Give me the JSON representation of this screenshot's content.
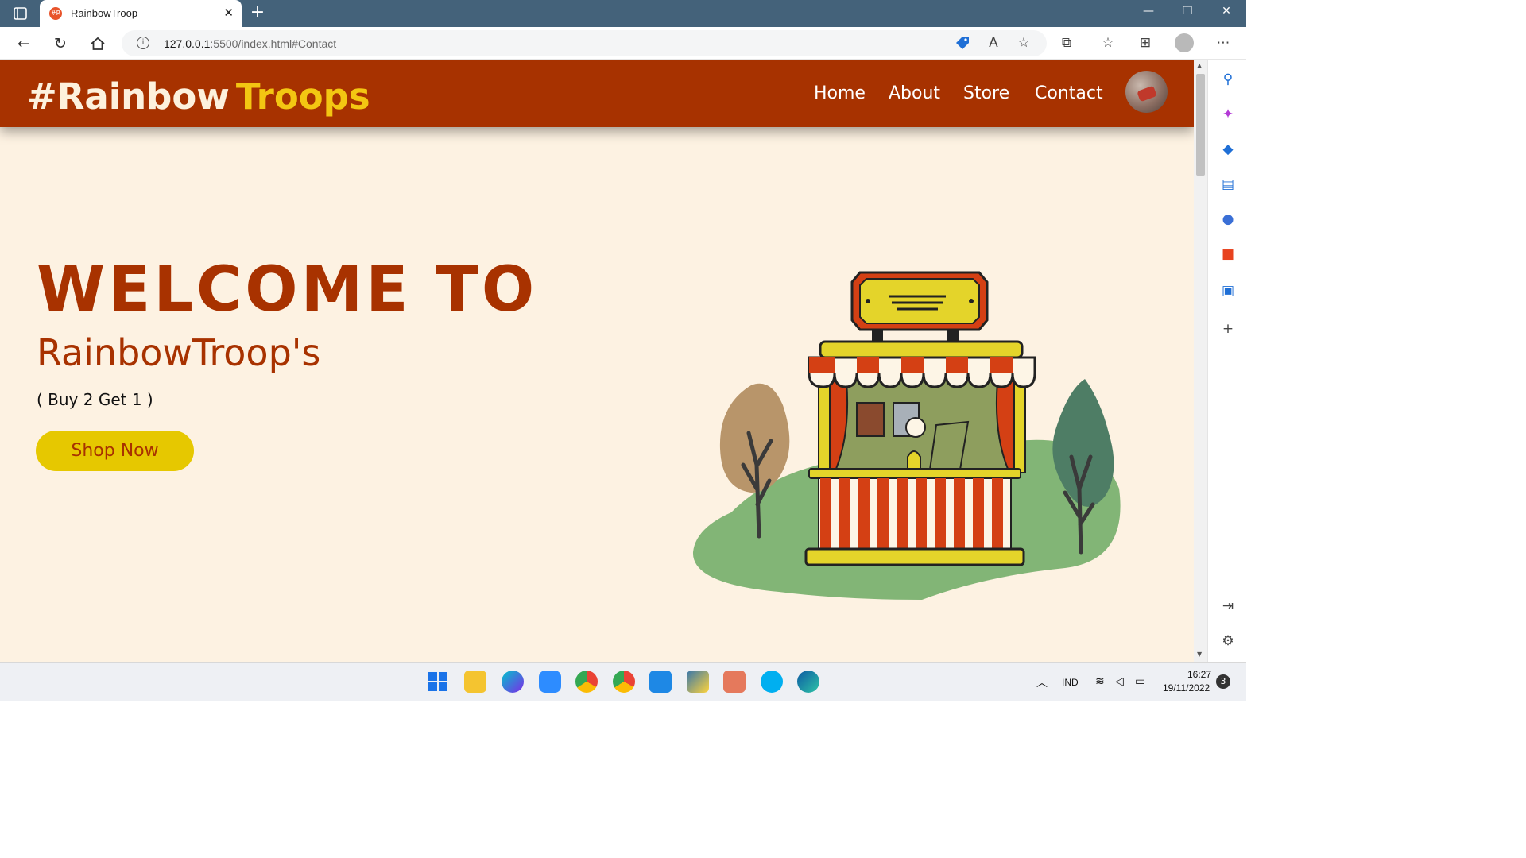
{
  "browser": {
    "tab_title": "RainbowTroop",
    "favicon_text": "#R",
    "url_host": "127.0.0.1",
    "url_rest": ":5500/index.html#Contact"
  },
  "site": {
    "logo_part1": "#Rainbow",
    "logo_part2": "Troops",
    "nav": [
      "Home",
      "About",
      "Store",
      "Contact"
    ],
    "hero": {
      "title": "WELCOME TO",
      "subtitle": "RainbowTroop's",
      "promo": "( Buy 2 Get 1 )",
      "button": "Shop Now"
    },
    "colors": {
      "header": "#a73200",
      "background": "#fdf2e2",
      "accent_yellow": "#e6c800",
      "text_brown": "#a83200"
    }
  },
  "taskbar": {
    "language": "IND",
    "time": "16:27",
    "date": "19/11/2022",
    "notification_count": "3"
  }
}
